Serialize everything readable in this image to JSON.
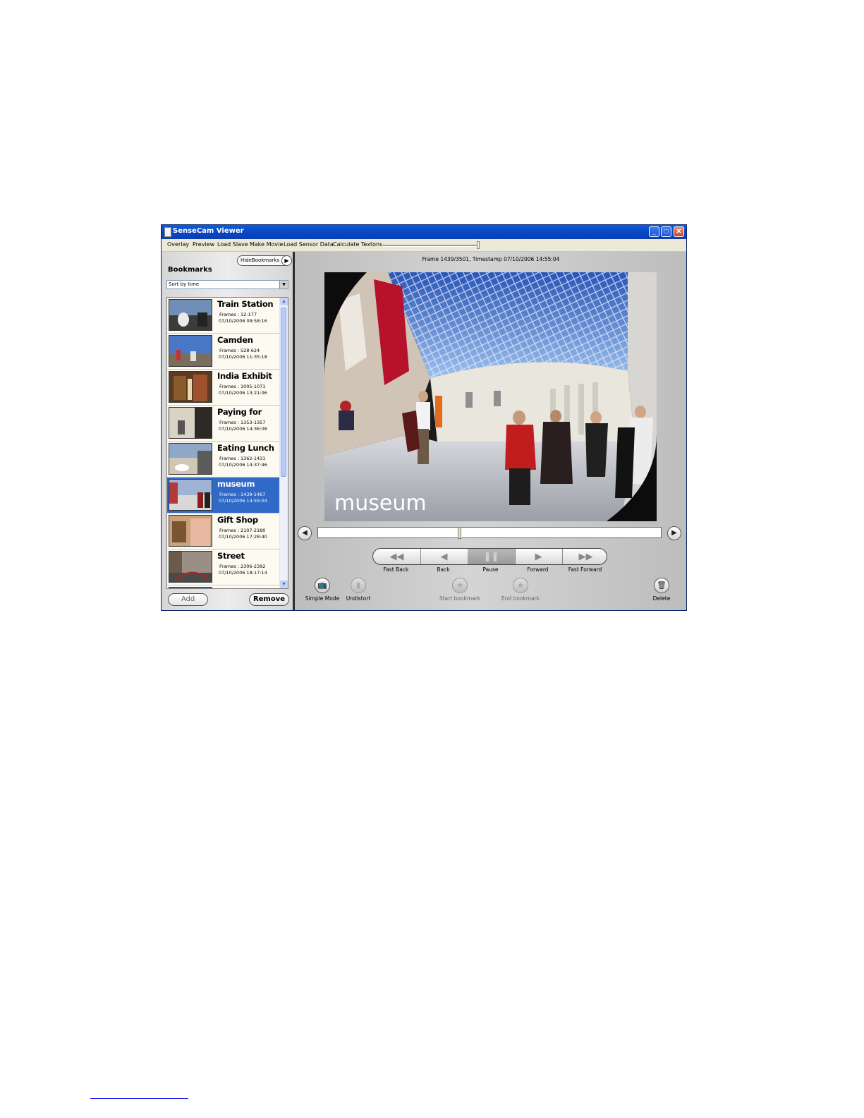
{
  "window": {
    "title": "SenseCam Viewer"
  },
  "menu": [
    "Overlay",
    "Preview",
    "Load Slave",
    "Make Movie",
    "Load Sensor Data",
    "Calculate Textons"
  ],
  "left_panel": {
    "title": "Bookmarks",
    "hide_button": "HideBookmarks",
    "sort_select": "Sort by time",
    "add_button": "Add",
    "remove_button": "Remove",
    "bookmarks": [
      {
        "name": "Train Station",
        "frames": "Frames : 12-177",
        "time": "07/10/2006 09:58:16"
      },
      {
        "name": "Camden",
        "frames": "Frames : 528-624",
        "time": "07/10/2006 11:35:18"
      },
      {
        "name": "India Exhibit",
        "frames": "Frames : 1005-1071",
        "time": "07/10/2006 13:21:06"
      },
      {
        "name": "Paying for",
        "frames": "Frames : 1353-1357",
        "time": "07/10/2006 14:36:08"
      },
      {
        "name": "Eating Lunch",
        "frames": "Frames : 1362-1431",
        "time": "07/10/2006 14:37:46"
      },
      {
        "name": "museum",
        "frames": "Frames : 1439-1467",
        "time": "07/10/2006 14:55:04",
        "selected": true
      },
      {
        "name": "Gift Shop",
        "frames": "Frames : 2107-2180",
        "time": "07/10/2006 17:28:40"
      },
      {
        "name": "Street",
        "frames": "Frames : 2306-2392",
        "time": "07/10/2006 18:17:14"
      }
    ]
  },
  "viewer": {
    "frame_info": "Frame 1439/3501, Timestamp 07/10/2006 14:55:04",
    "overlay_label": "museum",
    "timeline_position": 0.411
  },
  "transport": [
    {
      "label": "Fast Back",
      "icon": "fast-back-icon",
      "glyph": "◀◀",
      "active": false
    },
    {
      "label": "Back",
      "icon": "back-icon",
      "glyph": "◀",
      "active": false
    },
    {
      "label": "Pause",
      "icon": "pause-icon",
      "glyph": "❚❚",
      "active": true
    },
    {
      "label": "Forward",
      "icon": "forward-icon",
      "glyph": "▶",
      "active": false
    },
    {
      "label": "Fast Forward",
      "icon": "fast-forward-icon",
      "glyph": "▶▶",
      "active": false
    }
  ],
  "tools": {
    "simple_mode": "Simple Mode",
    "undistort": "Undistort",
    "start_bookmark": "Start bookmark",
    "end_bookmark": "End bookmark",
    "delete": "Delete"
  }
}
